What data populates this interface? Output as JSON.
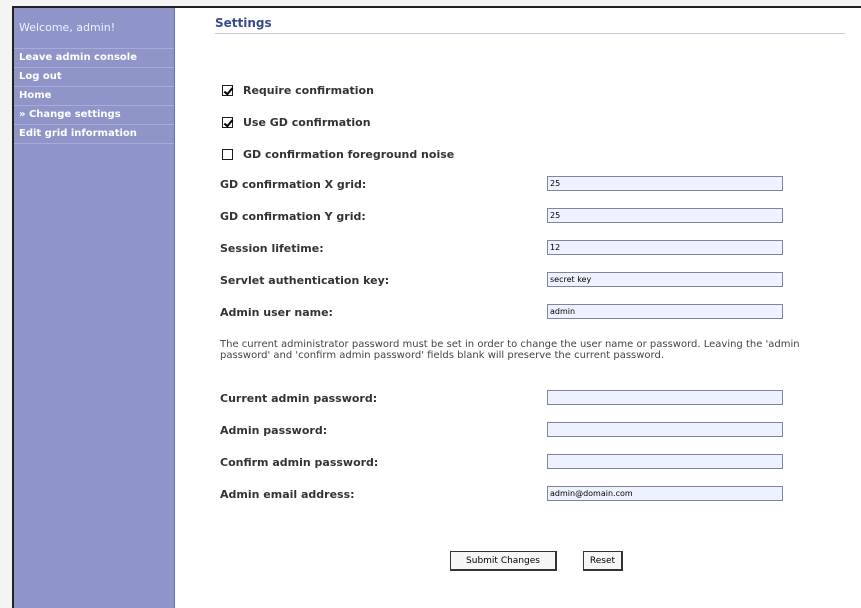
{
  "sidebar": {
    "welcome": "Welcome, admin!",
    "items": [
      {
        "label": "Leave admin console"
      },
      {
        "label": "Log out"
      },
      {
        "label": "Home"
      },
      {
        "label": "» Change settings"
      },
      {
        "label": "Edit grid information"
      }
    ]
  },
  "page": {
    "title": "Settings"
  },
  "checks": [
    {
      "label": "Require confirmation",
      "checked": true
    },
    {
      "label": "Use GD confirmation",
      "checked": true
    },
    {
      "label": "GD confirmation foreground noise",
      "checked": false
    }
  ],
  "fields": {
    "x_grid": {
      "label": "GD confirmation X grid:",
      "value": "25"
    },
    "y_grid": {
      "label": "GD confirmation Y grid:",
      "value": "25"
    },
    "session": {
      "label": "Session lifetime:",
      "value": "12"
    },
    "servlet_key": {
      "label": "Servlet authentication key:",
      "value": "secret key"
    },
    "admin_user": {
      "label": "Admin user name:",
      "value": "admin"
    },
    "current_pw": {
      "label": "Current admin password:",
      "value": ""
    },
    "admin_pw": {
      "label": "Admin password:",
      "value": ""
    },
    "confirm_pw": {
      "label": "Confirm admin password:",
      "value": ""
    },
    "admin_email": {
      "label": "Admin email address:",
      "value": "admin@domain.com"
    }
  },
  "note": "The current administrator password must be set in order to change the user name or password. Leaving the 'admin password' and 'confirm admin password' fields blank will preserve the current password.",
  "buttons": {
    "submit": "Submit Changes",
    "reset": "Reset"
  }
}
